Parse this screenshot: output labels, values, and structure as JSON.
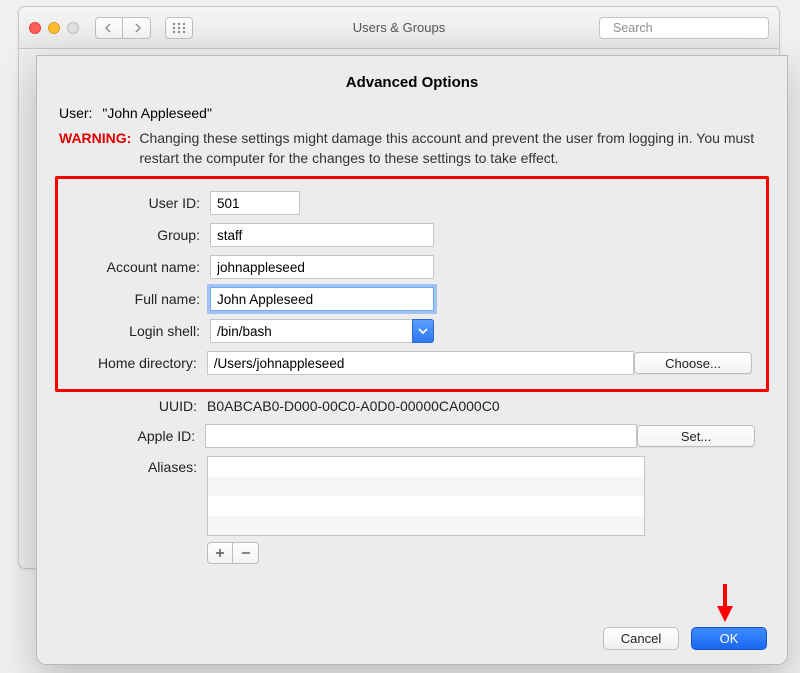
{
  "parentWindow": {
    "title": "Users & Groups",
    "searchPlaceholder": "Search"
  },
  "sheet": {
    "title": "Advanced Options",
    "userLabel": "User:",
    "userName": "\"John Appleseed\"",
    "warningLabel": "WARNING:",
    "warningText": "Changing these settings might damage this account and prevent the user from logging in. You must restart the computer for the changes to these settings to take effect."
  },
  "fields": {
    "userId": {
      "label": "User ID:",
      "value": "501"
    },
    "group": {
      "label": "Group:",
      "value": "staff"
    },
    "accountName": {
      "label": "Account name:",
      "value": "johnappleseed"
    },
    "fullName": {
      "label": "Full name:",
      "value": "John Appleseed"
    },
    "loginShell": {
      "label": "Login shell:",
      "value": "/bin/bash"
    },
    "homeDir": {
      "label": "Home directory:",
      "value": "/Users/johnappleseed"
    },
    "uuid": {
      "label": "UUID:",
      "value": "B0ABCAB0-D000-00C0-A0D0-00000CA000C0"
    },
    "appleId": {
      "label": "Apple ID:",
      "value": ""
    },
    "aliases": {
      "label": "Aliases:"
    }
  },
  "buttons": {
    "choose": "Choose...",
    "set": "Set...",
    "cancel": "Cancel",
    "ok": "OK"
  },
  "colors": {
    "warning": "#e00000",
    "highlight": "#ff0000",
    "primary": "#1868f2"
  }
}
